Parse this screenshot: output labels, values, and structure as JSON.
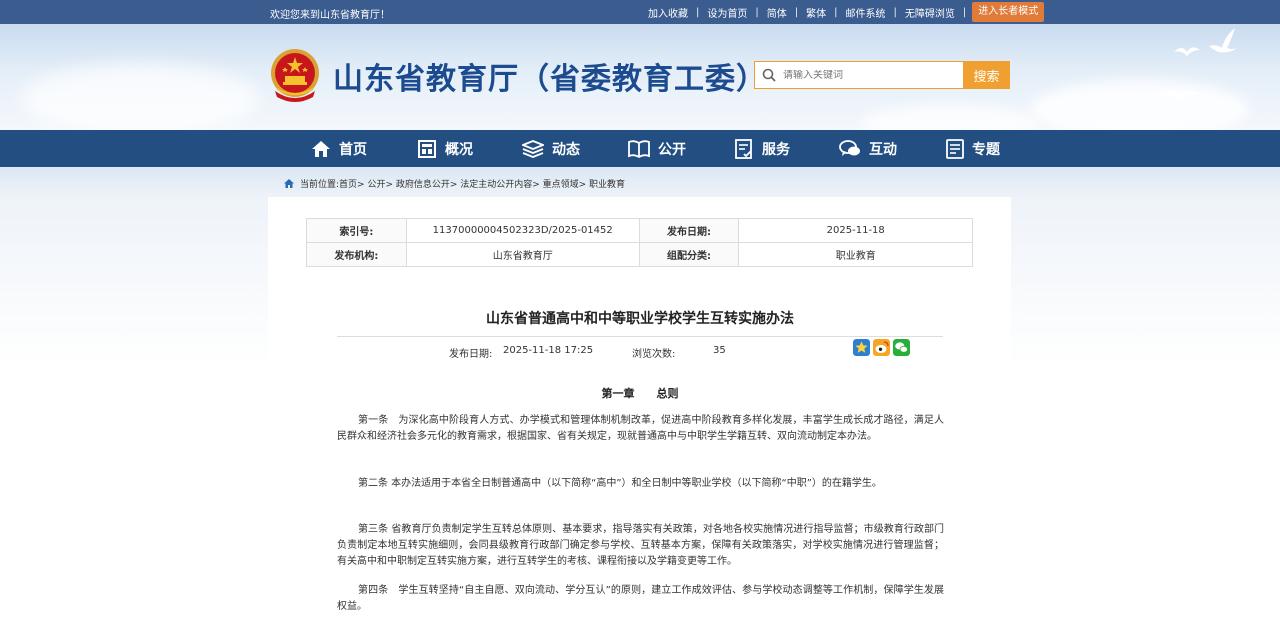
{
  "topbar": {
    "welcome": "欢迎您来到山东省教育厅！",
    "links": [
      "加入收藏",
      "设为首页",
      "简体",
      "繁体",
      "邮件系统",
      "无障碍浏览"
    ],
    "elder_mode": "进入长者模式"
  },
  "header": {
    "title": "山东省教育厅（省委教育工委）",
    "search_placeholder": "请输入关键词",
    "search_button": "搜索"
  },
  "nav": {
    "items": [
      {
        "label": "首页",
        "icon": "home-icon"
      },
      {
        "label": "概况",
        "icon": "overview-icon"
      },
      {
        "label": "动态",
        "icon": "news-icon"
      },
      {
        "label": "公开",
        "icon": "book-icon"
      },
      {
        "label": "服务",
        "icon": "service-icon"
      },
      {
        "label": "互动",
        "icon": "chat-icon"
      },
      {
        "label": "专题",
        "icon": "topic-icon"
      }
    ]
  },
  "breadcrumb": {
    "prefix": "当前位置:",
    "path": "首页> 公开> 政府信息公开> 法定主动公开内容> 重点领域> 职业教育"
  },
  "meta": {
    "index_label": "索引号:",
    "index_value": "11370000004502323D/2025-01452",
    "date_label": "发布日期:",
    "date_value": "2025-11-18",
    "org_label": "发布机构:",
    "org_value": "山东省教育厅",
    "category_label": "组配分类:",
    "category_value": "职业教育"
  },
  "article": {
    "title": "山东省普通高中和中等职业学校学生互转实施办法",
    "publish_label": "发布日期:",
    "publish_value": "2025-11-18 17:25",
    "views_label": "浏览次数:",
    "views_value": "35",
    "chapter": "第一章　　总则",
    "paragraphs": [
      "第一条　为深化高中阶段育人方式、办学模式和管理体制机制改革，促进高中阶段教育多样化发展，丰富学生成长成才路径，满足人民群众和经济社会多元化的教育需求，根据国家、省有关规定，现就普通高中与中职学生学籍互转、双向流动制定本办法。",
      "第二条  本办法适用于本省全日制普通高中（以下简称“高中”）和全日制中等职业学校（以下简称“中职”）的在籍学生。",
      "第三条  省教育厅负责制定学生互转总体原则、基本要求，指导落实有关政策，对各地各校实施情况进行指导监督；市级教育行政部门负责制定本地互转实施细则，会同县级教育行政部门确定参与学校、互转基本方案，保障有关政策落实，对学校实施情况进行管理监督；有关高中和中职制定互转实施方案，进行互转学生的考核、课程衔接以及学籍变更等工作。",
      "第四条　学生互转坚持“自主自愿、双向流动、学分互认”的原则，建立工作成效评估、参与学校动态调整等工作机制，保障学生发展权益。"
    ]
  },
  "colors": {
    "topbar": "#3a5c8f",
    "nav": "#234e82",
    "title_blue": "#1d4b8f",
    "accent_orange": "#f0a030",
    "elder_orange": "#e07b39"
  }
}
